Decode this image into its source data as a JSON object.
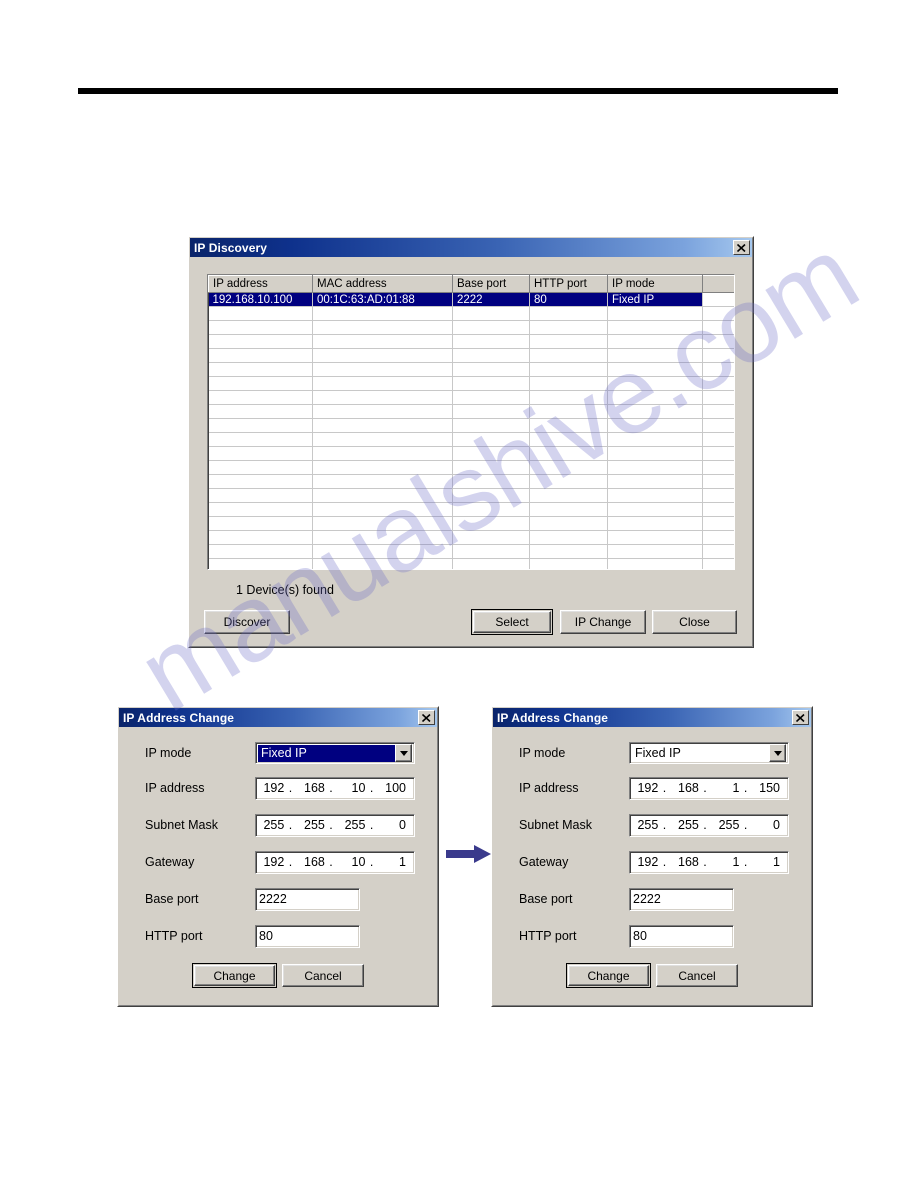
{
  "page": {
    "watermark_text": "manualshive.com"
  },
  "ip_discovery": {
    "title": "IP Discovery",
    "close_label": "×",
    "columns": [
      "IP address",
      "MAC address",
      "Base port",
      "HTTP port",
      "IP mode"
    ],
    "rows": [
      {
        "selected": true,
        "ip_address": "192.168.10.100",
        "mac_address": "00:1C:63:AD:01:88",
        "base_port": "2222",
        "http_port": "80",
        "ip_mode": "Fixed IP"
      }
    ],
    "empty_row_count": 19,
    "status": "1  Device(s) found",
    "buttons": {
      "discover": "Discover",
      "select": "Select",
      "ip_change": "IP Change",
      "close": "Close"
    }
  },
  "ip_change_left": {
    "title": "IP Address Change",
    "labels": {
      "ip_mode": "IP mode",
      "ip_address": "IP address",
      "subnet_mask": "Subnet Mask",
      "gateway": "Gateway",
      "base_port": "Base port",
      "http_port": "HTTP port"
    },
    "values": {
      "ip_mode": "Fixed IP",
      "ip_address": [
        "192",
        "168",
        "10",
        "100"
      ],
      "subnet_mask": [
        "255",
        "255",
        "255",
        "0"
      ],
      "gateway": [
        "192",
        "168",
        "10",
        "1"
      ],
      "base_port": "2222",
      "http_port": "80"
    },
    "buttons": {
      "change": "Change",
      "cancel": "Cancel"
    }
  },
  "ip_change_right": {
    "title": "IP Address Change",
    "labels": {
      "ip_mode": "IP mode",
      "ip_address": "IP address",
      "subnet_mask": "Subnet Mask",
      "gateway": "Gateway",
      "base_port": "Base port",
      "http_port": "HTTP port"
    },
    "values": {
      "ip_mode": "Fixed IP",
      "ip_address": [
        "192",
        "168",
        "1",
        "150"
      ],
      "subnet_mask": [
        "255",
        "255",
        "255",
        "0"
      ],
      "gateway": [
        "192",
        "168",
        "1",
        "1"
      ],
      "base_port": "2222",
      "http_port": "80"
    },
    "buttons": {
      "change": "Change",
      "cancel": "Cancel"
    }
  },
  "colors": {
    "title_gradient_start": "#0a246a",
    "title_gradient_end": "#a6c8ee",
    "dialog_face": "#d4d0c8",
    "selection": "#000080",
    "arrow": "#3a3a8c",
    "rule": "#000000"
  }
}
